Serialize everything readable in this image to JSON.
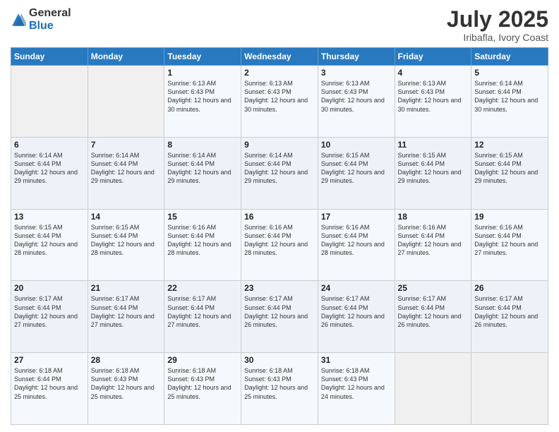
{
  "header": {
    "logo_general": "General",
    "logo_blue": "Blue",
    "month_title": "July 2025",
    "location": "Iribafla, Ivory Coast"
  },
  "weekdays": [
    "Sunday",
    "Monday",
    "Tuesday",
    "Wednesday",
    "Thursday",
    "Friday",
    "Saturday"
  ],
  "weeks": [
    [
      {
        "day": "",
        "sunrise": "",
        "sunset": "",
        "daylight": ""
      },
      {
        "day": "",
        "sunrise": "",
        "sunset": "",
        "daylight": ""
      },
      {
        "day": "1",
        "sunrise": "Sunrise: 6:13 AM",
        "sunset": "Sunset: 6:43 PM",
        "daylight": "Daylight: 12 hours and 30 minutes."
      },
      {
        "day": "2",
        "sunrise": "Sunrise: 6:13 AM",
        "sunset": "Sunset: 6:43 PM",
        "daylight": "Daylight: 12 hours and 30 minutes."
      },
      {
        "day": "3",
        "sunrise": "Sunrise: 6:13 AM",
        "sunset": "Sunset: 6:43 PM",
        "daylight": "Daylight: 12 hours and 30 minutes."
      },
      {
        "day": "4",
        "sunrise": "Sunrise: 6:13 AM",
        "sunset": "Sunset: 6:43 PM",
        "daylight": "Daylight: 12 hours and 30 minutes."
      },
      {
        "day": "5",
        "sunrise": "Sunrise: 6:14 AM",
        "sunset": "Sunset: 6:44 PM",
        "daylight": "Daylight: 12 hours and 30 minutes."
      }
    ],
    [
      {
        "day": "6",
        "sunrise": "Sunrise: 6:14 AM",
        "sunset": "Sunset: 6:44 PM",
        "daylight": "Daylight: 12 hours and 29 minutes."
      },
      {
        "day": "7",
        "sunrise": "Sunrise: 6:14 AM",
        "sunset": "Sunset: 6:44 PM",
        "daylight": "Daylight: 12 hours and 29 minutes."
      },
      {
        "day": "8",
        "sunrise": "Sunrise: 6:14 AM",
        "sunset": "Sunset: 6:44 PM",
        "daylight": "Daylight: 12 hours and 29 minutes."
      },
      {
        "day": "9",
        "sunrise": "Sunrise: 6:14 AM",
        "sunset": "Sunset: 6:44 PM",
        "daylight": "Daylight: 12 hours and 29 minutes."
      },
      {
        "day": "10",
        "sunrise": "Sunrise: 6:15 AM",
        "sunset": "Sunset: 6:44 PM",
        "daylight": "Daylight: 12 hours and 29 minutes."
      },
      {
        "day": "11",
        "sunrise": "Sunrise: 6:15 AM",
        "sunset": "Sunset: 6:44 PM",
        "daylight": "Daylight: 12 hours and 29 minutes."
      },
      {
        "day": "12",
        "sunrise": "Sunrise: 6:15 AM",
        "sunset": "Sunset: 6:44 PM",
        "daylight": "Daylight: 12 hours and 29 minutes."
      }
    ],
    [
      {
        "day": "13",
        "sunrise": "Sunrise: 6:15 AM",
        "sunset": "Sunset: 6:44 PM",
        "daylight": "Daylight: 12 hours and 28 minutes."
      },
      {
        "day": "14",
        "sunrise": "Sunrise: 6:15 AM",
        "sunset": "Sunset: 6:44 PM",
        "daylight": "Daylight: 12 hours and 28 minutes."
      },
      {
        "day": "15",
        "sunrise": "Sunrise: 6:16 AM",
        "sunset": "Sunset: 6:44 PM",
        "daylight": "Daylight: 12 hours and 28 minutes."
      },
      {
        "day": "16",
        "sunrise": "Sunrise: 6:16 AM",
        "sunset": "Sunset: 6:44 PM",
        "daylight": "Daylight: 12 hours and 28 minutes."
      },
      {
        "day": "17",
        "sunrise": "Sunrise: 6:16 AM",
        "sunset": "Sunset: 6:44 PM",
        "daylight": "Daylight: 12 hours and 28 minutes."
      },
      {
        "day": "18",
        "sunrise": "Sunrise: 6:16 AM",
        "sunset": "Sunset: 6:44 PM",
        "daylight": "Daylight: 12 hours and 27 minutes."
      },
      {
        "day": "19",
        "sunrise": "Sunrise: 6:16 AM",
        "sunset": "Sunset: 6:44 PM",
        "daylight": "Daylight: 12 hours and 27 minutes."
      }
    ],
    [
      {
        "day": "20",
        "sunrise": "Sunrise: 6:17 AM",
        "sunset": "Sunset: 6:44 PM",
        "daylight": "Daylight: 12 hours and 27 minutes."
      },
      {
        "day": "21",
        "sunrise": "Sunrise: 6:17 AM",
        "sunset": "Sunset: 6:44 PM",
        "daylight": "Daylight: 12 hours and 27 minutes."
      },
      {
        "day": "22",
        "sunrise": "Sunrise: 6:17 AM",
        "sunset": "Sunset: 6:44 PM",
        "daylight": "Daylight: 12 hours and 27 minutes."
      },
      {
        "day": "23",
        "sunrise": "Sunrise: 6:17 AM",
        "sunset": "Sunset: 6:44 PM",
        "daylight": "Daylight: 12 hours and 26 minutes."
      },
      {
        "day": "24",
        "sunrise": "Sunrise: 6:17 AM",
        "sunset": "Sunset: 6:44 PM",
        "daylight": "Daylight: 12 hours and 26 minutes."
      },
      {
        "day": "25",
        "sunrise": "Sunrise: 6:17 AM",
        "sunset": "Sunset: 6:44 PM",
        "daylight": "Daylight: 12 hours and 26 minutes."
      },
      {
        "day": "26",
        "sunrise": "Sunrise: 6:17 AM",
        "sunset": "Sunset: 6:44 PM",
        "daylight": "Daylight: 12 hours and 26 minutes."
      }
    ],
    [
      {
        "day": "27",
        "sunrise": "Sunrise: 6:18 AM",
        "sunset": "Sunset: 6:44 PM",
        "daylight": "Daylight: 12 hours and 25 minutes."
      },
      {
        "day": "28",
        "sunrise": "Sunrise: 6:18 AM",
        "sunset": "Sunset: 6:43 PM",
        "daylight": "Daylight: 12 hours and 25 minutes."
      },
      {
        "day": "29",
        "sunrise": "Sunrise: 6:18 AM",
        "sunset": "Sunset: 6:43 PM",
        "daylight": "Daylight: 12 hours and 25 minutes."
      },
      {
        "day": "30",
        "sunrise": "Sunrise: 6:18 AM",
        "sunset": "Sunset: 6:43 PM",
        "daylight": "Daylight: 12 hours and 25 minutes."
      },
      {
        "day": "31",
        "sunrise": "Sunrise: 6:18 AM",
        "sunset": "Sunset: 6:43 PM",
        "daylight": "Daylight: 12 hours and 24 minutes."
      },
      {
        "day": "",
        "sunrise": "",
        "sunset": "",
        "daylight": ""
      },
      {
        "day": "",
        "sunrise": "",
        "sunset": "",
        "daylight": ""
      }
    ]
  ]
}
